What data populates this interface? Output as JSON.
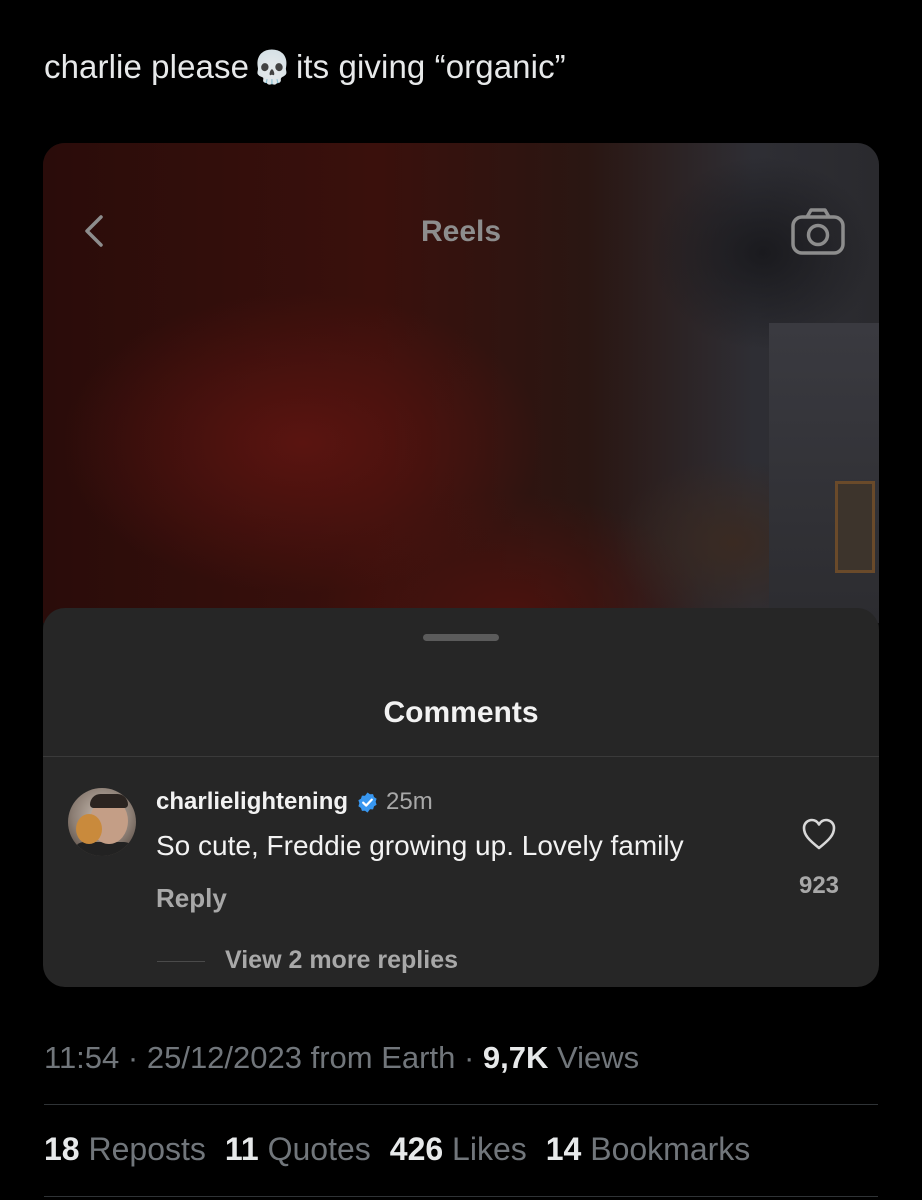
{
  "tweet": {
    "text_before": "charlie please",
    "emoji": "💀",
    "text_after": "its giving “organic”"
  },
  "reel": {
    "header_title": "Reels",
    "icons": {
      "back": "chevron-left-icon",
      "camera": "camera-icon"
    }
  },
  "comments_sheet": {
    "title": "Comments",
    "comment": {
      "username": "charlielightening",
      "verified": true,
      "time": "25m",
      "text": "So cute, Freddie growing up. Lovely family",
      "reply_label": "Reply",
      "like_count": "923",
      "view_replies_label": "View 2 more replies"
    }
  },
  "meta": {
    "time": "11:54",
    "date": "25/12/2023",
    "source": "from Earth",
    "views_count": "9,7K",
    "views_label": "Views"
  },
  "stats": {
    "reposts_count": "18",
    "reposts_label": "Reposts",
    "quotes_count": "11",
    "quotes_label": "Quotes",
    "likes_count": "426",
    "likes_label": "Likes",
    "bookmarks_count": "14",
    "bookmarks_label": "Bookmarks"
  },
  "colors": {
    "background": "#000000",
    "sheet": "#262626",
    "verified_blue": "#3897f0",
    "muted": "#71767b"
  }
}
